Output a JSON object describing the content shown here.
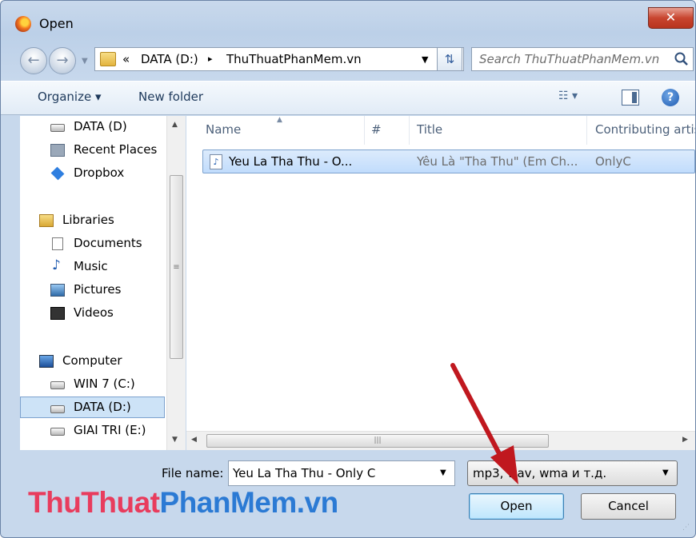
{
  "window": {
    "title": "Open",
    "close_glyph": "✕"
  },
  "address_bar": {
    "chevron": "«",
    "segment1": "DATA (D:)",
    "separator": "▸",
    "segment2": "ThuThuatPhanMem.vn"
  },
  "search": {
    "placeholder": "Search ThuThuatPhanMem.vn"
  },
  "toolbar": {
    "organize_label": "Organize ▾",
    "new_folder_label": "New folder",
    "view_glyph": "☷ ▾",
    "help_glyph": "?"
  },
  "nav_pane": {
    "items": [
      {
        "label": "DATA (D)",
        "icon": "drive-icon"
      },
      {
        "label": "Recent Places",
        "icon": "recent-places-icon"
      },
      {
        "label": "Dropbox",
        "icon": "dropbox-icon"
      },
      {
        "label": "Libraries",
        "icon": "libraries-icon"
      },
      {
        "label": "Documents",
        "icon": "documents-icon"
      },
      {
        "label": "Music",
        "icon": "music-icon"
      },
      {
        "label": "Pictures",
        "icon": "pictures-icon"
      },
      {
        "label": "Videos",
        "icon": "videos-icon"
      },
      {
        "label": "Computer",
        "icon": "computer-icon"
      },
      {
        "label": "WIN 7 (C:)",
        "icon": "drive-icon"
      },
      {
        "label": "DATA (D:)",
        "icon": "drive-icon",
        "selected": true
      },
      {
        "label": "GIAI TRI (E:)",
        "icon": "drive-icon"
      }
    ]
  },
  "file_list": {
    "columns": [
      "Name",
      "#",
      "Title",
      "Contributing artis"
    ],
    "rows": [
      {
        "name": "Yeu La Tha Thu - O...",
        "track": "",
        "title": "Yêu Là \"Tha Thu\" (Em Ch...",
        "artist": "OnlyC"
      }
    ]
  },
  "bottom": {
    "filename_label": "File name:",
    "filename_value": "Yeu La Tha Thu - Only C",
    "filetype_value": "mp3, wav, wma и т.д.",
    "open_label": "Open",
    "cancel_label": "Cancel"
  },
  "watermark": {
    "part1": "ThuThuat",
    "part2": "PhanMem",
    "suffix": ".vn"
  },
  "colors": {
    "watermark_red": "#e83c5d",
    "watermark_blue": "#2b7ad4",
    "annotation_arrow": "#c0181f"
  }
}
